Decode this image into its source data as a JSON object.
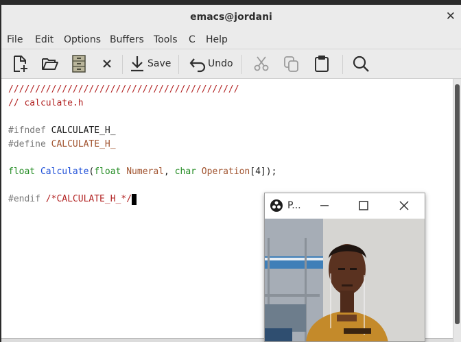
{
  "window": {
    "title": "emacs@jordani",
    "close_glyph": "✕"
  },
  "menu": {
    "items": [
      "File",
      "Edit",
      "Options",
      "Buffers",
      "Tools",
      "C",
      "Help"
    ]
  },
  "toolbar": {
    "new_file_icon": "new-file-icon",
    "open_icon": "folder-open-icon",
    "dired_icon": "file-cabinet-icon",
    "close_buffer_icon": "close-icon",
    "save_label": "Save",
    "undo_label": "Undo",
    "cut_icon": "scissors-icon",
    "copy_icon": "copy-icon",
    "paste_icon": "clipboard-icon",
    "search_icon": "search-icon"
  },
  "editor": {
    "line1": "///////////////////////////////////////////",
    "line2": "// calculate.h",
    "line3_kw": "#ifndef",
    "line3_name": " CALCULATE_H_",
    "line4_kw": "#define",
    "line4_name": " CALCULATE_H_",
    "line5_type1": "float",
    "line5_func": " Calculate",
    "line5_p1": "(",
    "line5_type2": "float",
    "line5_arg1": " Numeral",
    "line5_p2": ", ",
    "line5_type3": "char",
    "line5_arg2": " Operation",
    "line5_p3": "[4]);",
    "line6_kw": "#endif",
    "line6_comment": " /*CALCULATE_H_*/"
  },
  "overlay": {
    "title": "P...",
    "app_icon": "obs-icon",
    "minimize_icon": "minimize-icon",
    "maximize_icon": "maximize-icon",
    "close_icon": "close-icon"
  },
  "colors": {
    "comment": "#b22222",
    "keyword_type": "#228b22",
    "function_name": "#1e4fd8",
    "variable": "#a0522d",
    "preprocessor": "#7a7a7a"
  }
}
